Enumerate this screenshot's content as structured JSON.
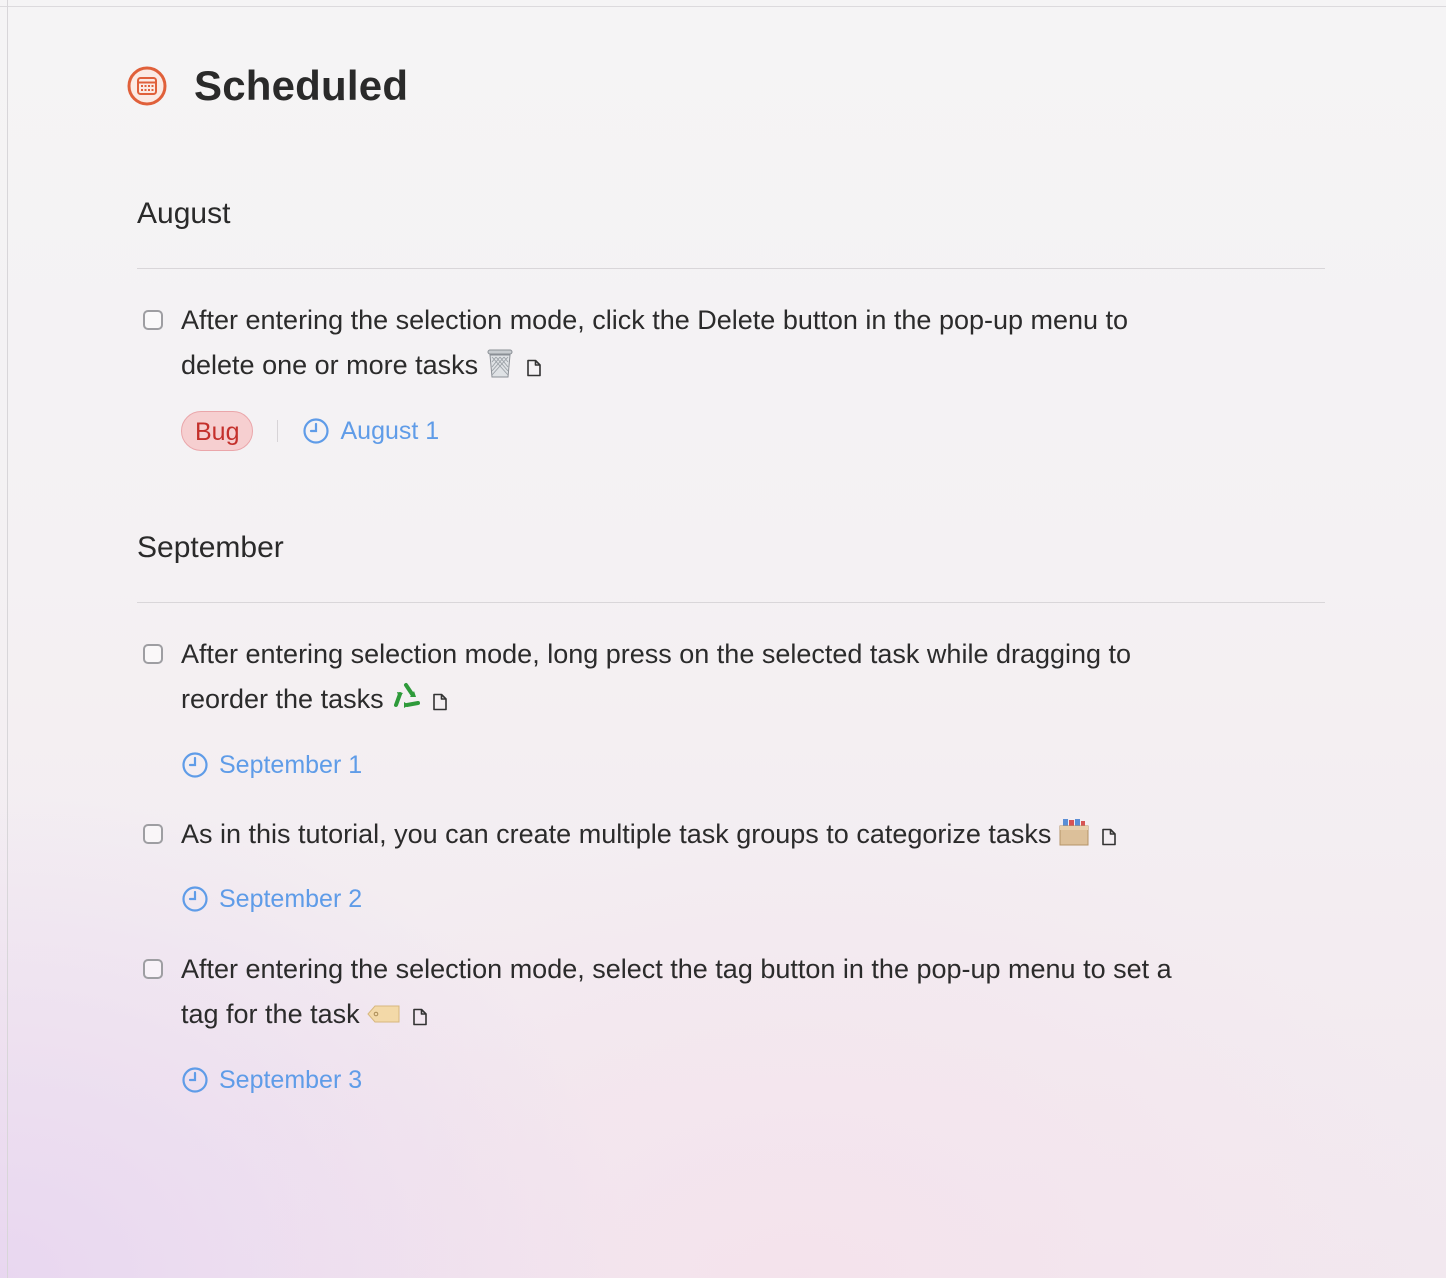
{
  "header": {
    "title": "Scheduled",
    "icon": "calendar-icon",
    "icon_color": "#e0603a"
  },
  "colors": {
    "due_date": "#5f9ce8",
    "tag_bug_text": "#c4302b",
    "tag_bug_bg": "#f6cfd0"
  },
  "sections": [
    {
      "title": "August",
      "tasks": [
        {
          "text_line1": "After entering the selection mode, click the Delete button in the pop-up menu to",
          "text_line2": "delete one or more tasks",
          "emoji": "wastebasket-emoji",
          "note_icon": "note-icon",
          "tag": "Bug",
          "due": "August 1"
        }
      ]
    },
    {
      "title": "September",
      "tasks": [
        {
          "text_line1": "After entering selection mode, long press on the selected task while dragging to",
          "text_line2": "reorder the tasks",
          "emoji": "recycle-emoji",
          "note_icon": "note-icon",
          "due": "September 1"
        },
        {
          "text_line1": "As in this tutorial, you can create multiple task groups to categorize tasks",
          "emoji": "card-file-box-emoji",
          "note_icon": "note-icon",
          "due": "September 2"
        },
        {
          "text_line1": "After entering the selection mode, select the tag button in the pop-up menu to set a",
          "text_line2": "tag for the task",
          "emoji": "label-emoji",
          "note_icon": "note-icon",
          "due": "September 3"
        }
      ]
    }
  ]
}
